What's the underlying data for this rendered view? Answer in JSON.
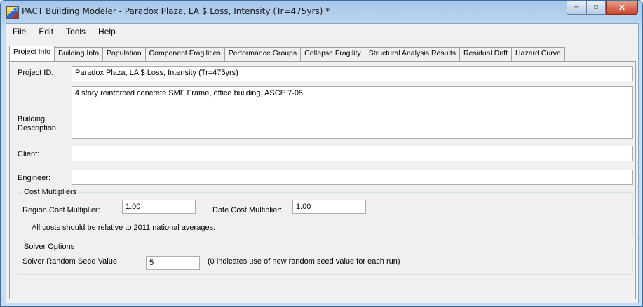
{
  "window": {
    "title": "PACT Building Modeler - Paradox Plaza, LA  $ Loss, Intensity (Tr=475yrs) *",
    "icon_text": "PACT"
  },
  "menu": [
    "File",
    "Edit",
    "Tools",
    "Help"
  ],
  "tabs": [
    {
      "label": "Project Info",
      "active": true
    },
    {
      "label": "Building Info"
    },
    {
      "label": "Population"
    },
    {
      "label": "Component Fragilities"
    },
    {
      "label": "Performance Groups"
    },
    {
      "label": "Collapse Fragility"
    },
    {
      "label": "Structural Analysis Results"
    },
    {
      "label": "Residual Drift"
    },
    {
      "label": "Hazard Curve"
    }
  ],
  "project": {
    "id_label": "Project ID:",
    "id_value": "Paradox Plaza, LA  $ Loss, Intensity (Tr=475yrs)",
    "desc_label_1": "Building",
    "desc_label_2": "Description:",
    "desc_value": "4 story reinforced concrete SMF Frame, office building, ASCE 7-05",
    "client_label": "Client:",
    "client_value": "",
    "engineer_label": "Engineer:",
    "engineer_value": ""
  },
  "cost": {
    "group_label": "Cost Multipliers",
    "region_label": "Region Cost Multiplier:",
    "region_value": "1.00",
    "date_label": "Date Cost Multiplier:",
    "date_value": "1.00",
    "note": "All costs should be relative to 2011 national averages."
  },
  "solver": {
    "group_label": "Solver Options",
    "seed_label": "Solver Random Seed Value",
    "seed_value": "5",
    "seed_note": "(0 indicates use of new random seed value for each run)"
  }
}
